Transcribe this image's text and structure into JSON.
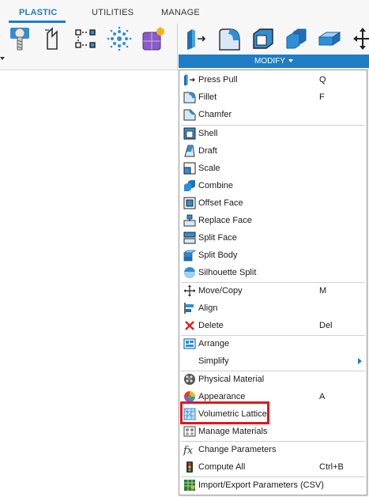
{
  "tabs": [
    {
      "label": "PLASTIC",
      "active": true
    },
    {
      "label": "UTILITIES",
      "active": false
    },
    {
      "label": "MANAGE",
      "active": false
    }
  ],
  "toolbar": {
    "left_tools": [
      "screw-boss-icon",
      "snap-fit-icon",
      "rest-icon",
      "lip-icon",
      "rule-fillet-icon"
    ],
    "modify_tools": [
      "press-pull-icon",
      "fillet-icon",
      "shell-icon",
      "combine-icon",
      "offset-face-icon",
      "move-icon"
    ],
    "modify_label": "MODIFY"
  },
  "menu": {
    "items": [
      {
        "label": "Press Pull",
        "shortcut": "Q",
        "icon": "press-pull-icon"
      },
      {
        "label": "Fillet",
        "shortcut": "F",
        "icon": "fillet-icon"
      },
      {
        "label": "Chamfer",
        "shortcut": "",
        "icon": "chamfer-icon"
      },
      {
        "label": "Shell",
        "shortcut": "",
        "icon": "shell-icon"
      },
      {
        "label": "Draft",
        "shortcut": "",
        "icon": "draft-icon"
      },
      {
        "label": "Scale",
        "shortcut": "",
        "icon": "scale-icon"
      },
      {
        "label": "Combine",
        "shortcut": "",
        "icon": "combine-icon"
      },
      {
        "label": "Offset Face",
        "shortcut": "",
        "icon": "offset-face-icon"
      },
      {
        "label": "Replace Face",
        "shortcut": "",
        "icon": "replace-face-icon"
      },
      {
        "label": "Split Face",
        "shortcut": "",
        "icon": "split-face-icon"
      },
      {
        "label": "Split Body",
        "shortcut": "",
        "icon": "split-body-icon"
      },
      {
        "label": "Silhouette Split",
        "shortcut": "",
        "icon": "silhouette-split-icon"
      },
      {
        "label": "Move/Copy",
        "shortcut": "M",
        "icon": "move-copy-icon"
      },
      {
        "label": "Align",
        "shortcut": "",
        "icon": "align-icon"
      },
      {
        "label": "Delete",
        "shortcut": "Del",
        "icon": "delete-icon"
      },
      {
        "label": "Arrange",
        "shortcut": "",
        "icon": "arrange-icon"
      },
      {
        "label": "Simplify",
        "shortcut": "",
        "icon": "",
        "submenu": true
      },
      {
        "label": "Physical Material",
        "shortcut": "",
        "icon": "physical-material-icon"
      },
      {
        "label": "Appearance",
        "shortcut": "A",
        "icon": "appearance-icon"
      },
      {
        "label": "Volumetric Lattice",
        "shortcut": "",
        "icon": "volumetric-lattice-icon",
        "highlighted": true
      },
      {
        "label": "Manage Materials",
        "shortcut": "",
        "icon": "manage-materials-icon"
      },
      {
        "label": "Change Parameters",
        "shortcut": "",
        "icon": "change-parameters-icon"
      },
      {
        "label": "Compute All",
        "shortcut": "Ctrl+B",
        "icon": "compute-all-icon"
      },
      {
        "label": "Import/Export Parameters (CSV)",
        "shortcut": "",
        "icon": "import-export-parameters-icon"
      }
    ]
  },
  "colors": {
    "accent": "#1e7dc4",
    "highlight_box": "#e3161c"
  }
}
